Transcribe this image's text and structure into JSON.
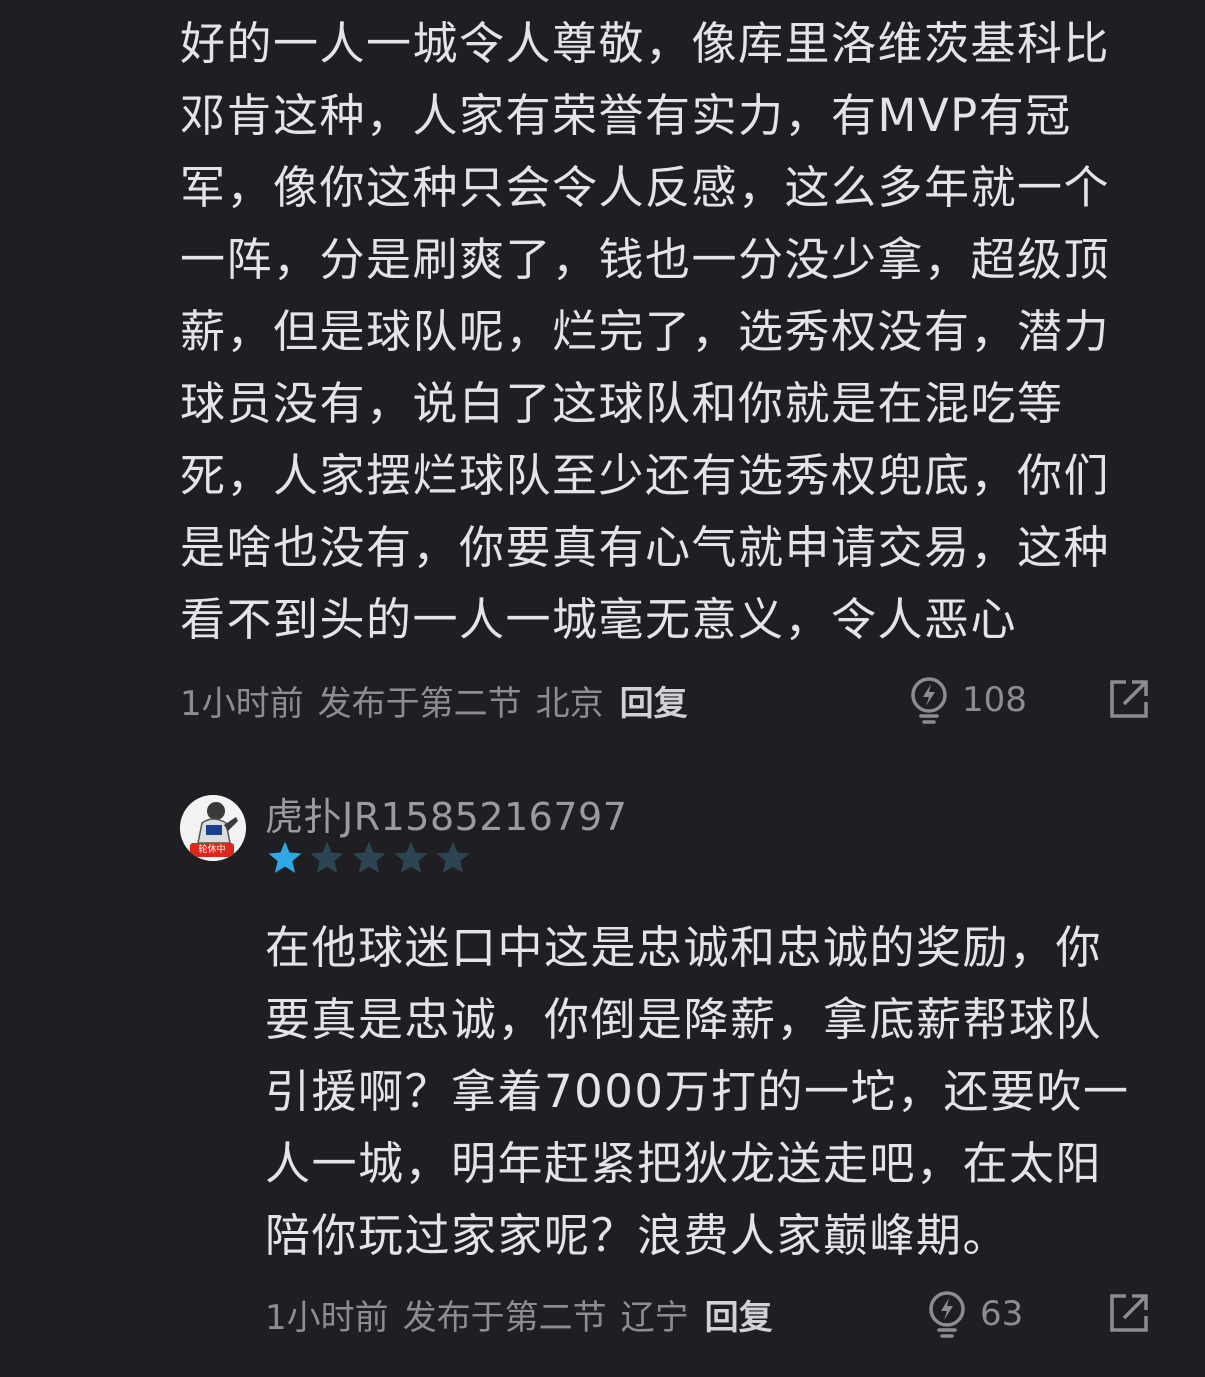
{
  "comments": [
    {
      "body_lines": [
        "好的一人一城令人尊敬，像库里洛维茨基科比",
        "邓肯这种，人家有荣誉有实力，有MVP有冠",
        "军，像你这种只会令人反感，这么多年就一个",
        "一阵，分是刷爽了，钱也一分没少拿，超级顶",
        "薪，但是球队呢，烂完了，选秀权没有，潜力",
        "球员没有，说白了这球队和你就是在混吃等",
        "死，人家摆烂球队至少还有选秀权兜底，你们",
        "是啥也没有，你要真有心气就申请交易，这种",
        "看不到头的一人一城毫无意义，令人恶心"
      ],
      "time": "1小时前",
      "posted_in": "发布于第二节",
      "location": "北京",
      "reply_label": "回复",
      "likes": "108"
    },
    {
      "username": "虎扑JR1585216797",
      "avatar_badge": "轮休中",
      "rating_filled": 1,
      "rating_total": 5,
      "body_lines": [
        "在他球迷口中这是忠诚和忠诚的奖励，你",
        "要真是忠诚，你倒是降薪，拿底薪帮球队",
        "引援啊？拿着7000万打的一坨，还要吹一",
        "人一城，明年赶紧把狄龙送走吧，在太阳",
        "陪你玩过家家呢？浪费人家巅峰期。"
      ],
      "time": "1小时前",
      "posted_in": "发布于第二节",
      "location": "辽宁",
      "reply_label": "回复",
      "likes": "63"
    }
  ],
  "colors": {
    "background": "#1f1f23",
    "text": "#e4e4e6",
    "meta": "#8c8c94",
    "star_filled": "#2fa8e6",
    "star_empty": "#2d4552"
  },
  "icons": {
    "like": "lightbulb-icon",
    "share": "share-icon"
  }
}
